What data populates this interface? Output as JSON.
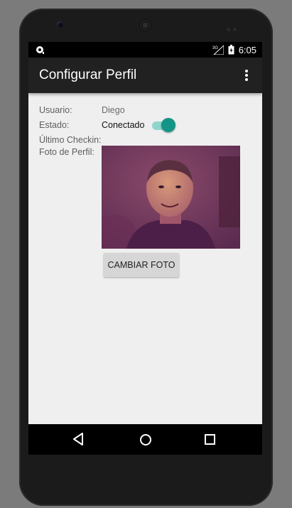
{
  "status_bar": {
    "time": "6:05",
    "network": "3G",
    "left_icon": "cast-icon",
    "icons": [
      "signal-icon",
      "battery-icon"
    ]
  },
  "app_bar": {
    "title": "Configurar Perfil",
    "overflow_icon": "more-vert-icon"
  },
  "profile": {
    "user_label": "Usuario:",
    "user_value": "Diego",
    "status_label": "Estado:",
    "status_value": "Conectado",
    "status_toggle_on": true,
    "last_checkin_label": "Último Checkin:",
    "last_checkin_value": "",
    "photo_label": "Foto de Perfil:",
    "change_photo_button": "CAMBIAR FOTO"
  },
  "colors": {
    "accent": "#129587",
    "accent_track": "#8fd5cc",
    "app_bar": "#212121",
    "background": "#efefef"
  },
  "nav_bar": {
    "icons": [
      "back-icon",
      "home-icon",
      "recents-icon"
    ]
  }
}
